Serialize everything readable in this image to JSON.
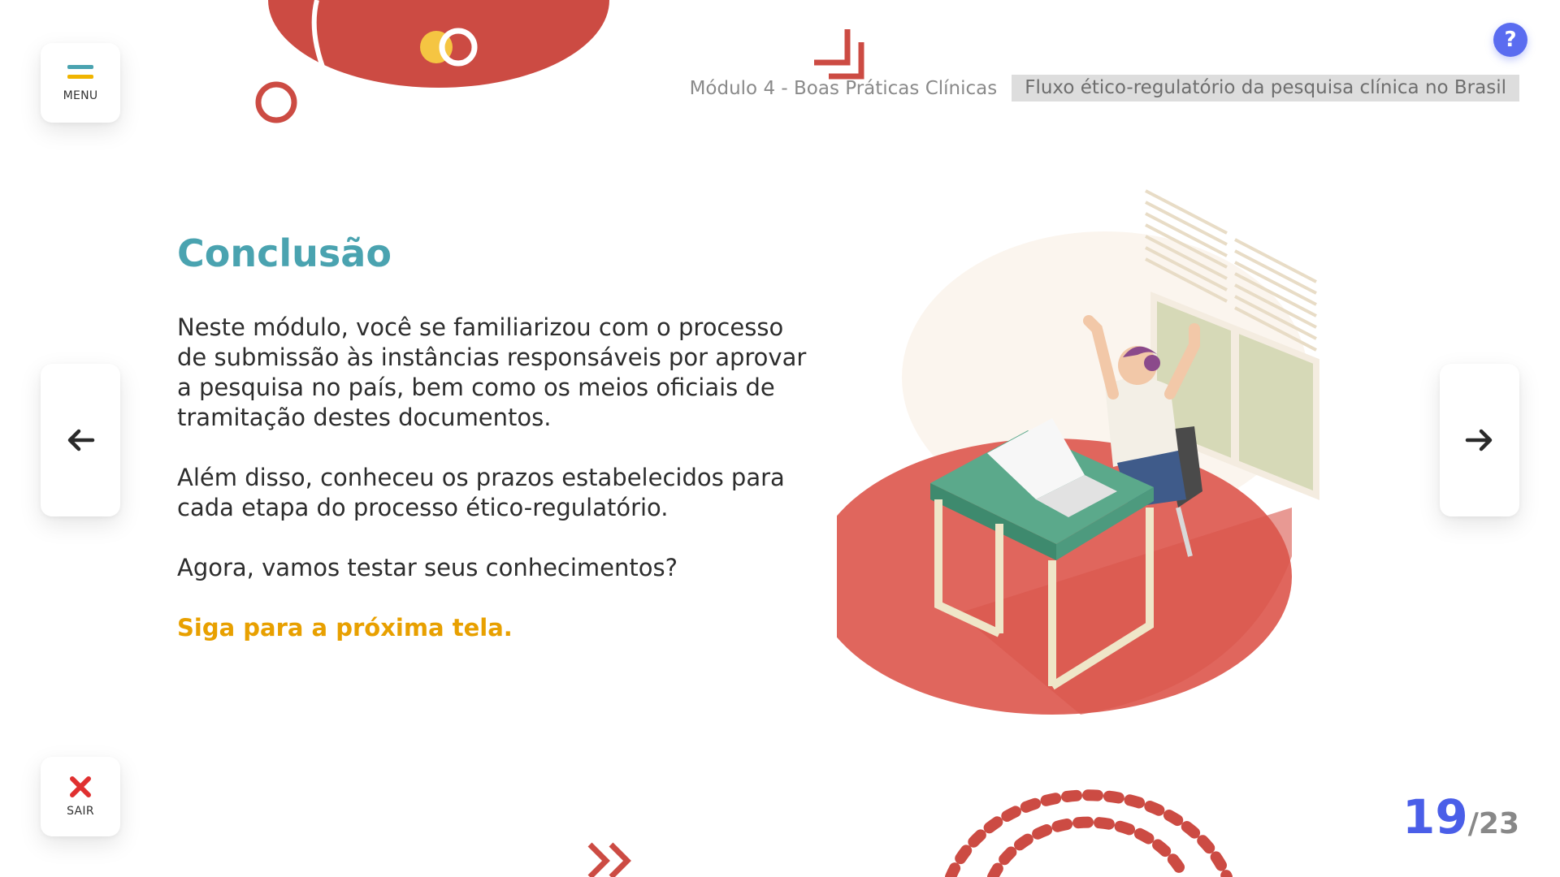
{
  "menu": {
    "label": "MENU"
  },
  "exit": {
    "label": "SAIR"
  },
  "help": {
    "label": "?"
  },
  "header": {
    "module": "Módulo 4 - Boas Práticas Clínicas",
    "topic": "Fluxo ético-regulatório da pesquisa clínica no Brasil"
  },
  "main": {
    "title": "Conclusão",
    "paragraphs": [
      "Neste módulo, você se familiarizou com o processo de submissão às instâncias responsáveis por aprovar a pesquisa no país, bem como os meios oficiais de tramitação destes documentos.",
      "Além disso, conheceu os prazos estabelecidos para cada etapa do processo ético-regulatório.",
      "Agora, vamos testar seus conhecimentos?"
    ],
    "cta": "Siga para a próxima tela."
  },
  "pagination": {
    "current": "19",
    "total": "/23"
  },
  "icons": {
    "menu": "hamburger-menu-icon",
    "exit": "close-x-icon",
    "prev": "arrow-left-icon",
    "next": "arrow-right-icon",
    "help": "question-mark-icon"
  },
  "colors": {
    "accent_red": "#cc4b43",
    "title_teal": "#4aa3b0",
    "cta_orange": "#e8a000",
    "counter_blue": "#4a5ee8",
    "help_blue": "#5a6cf0"
  }
}
